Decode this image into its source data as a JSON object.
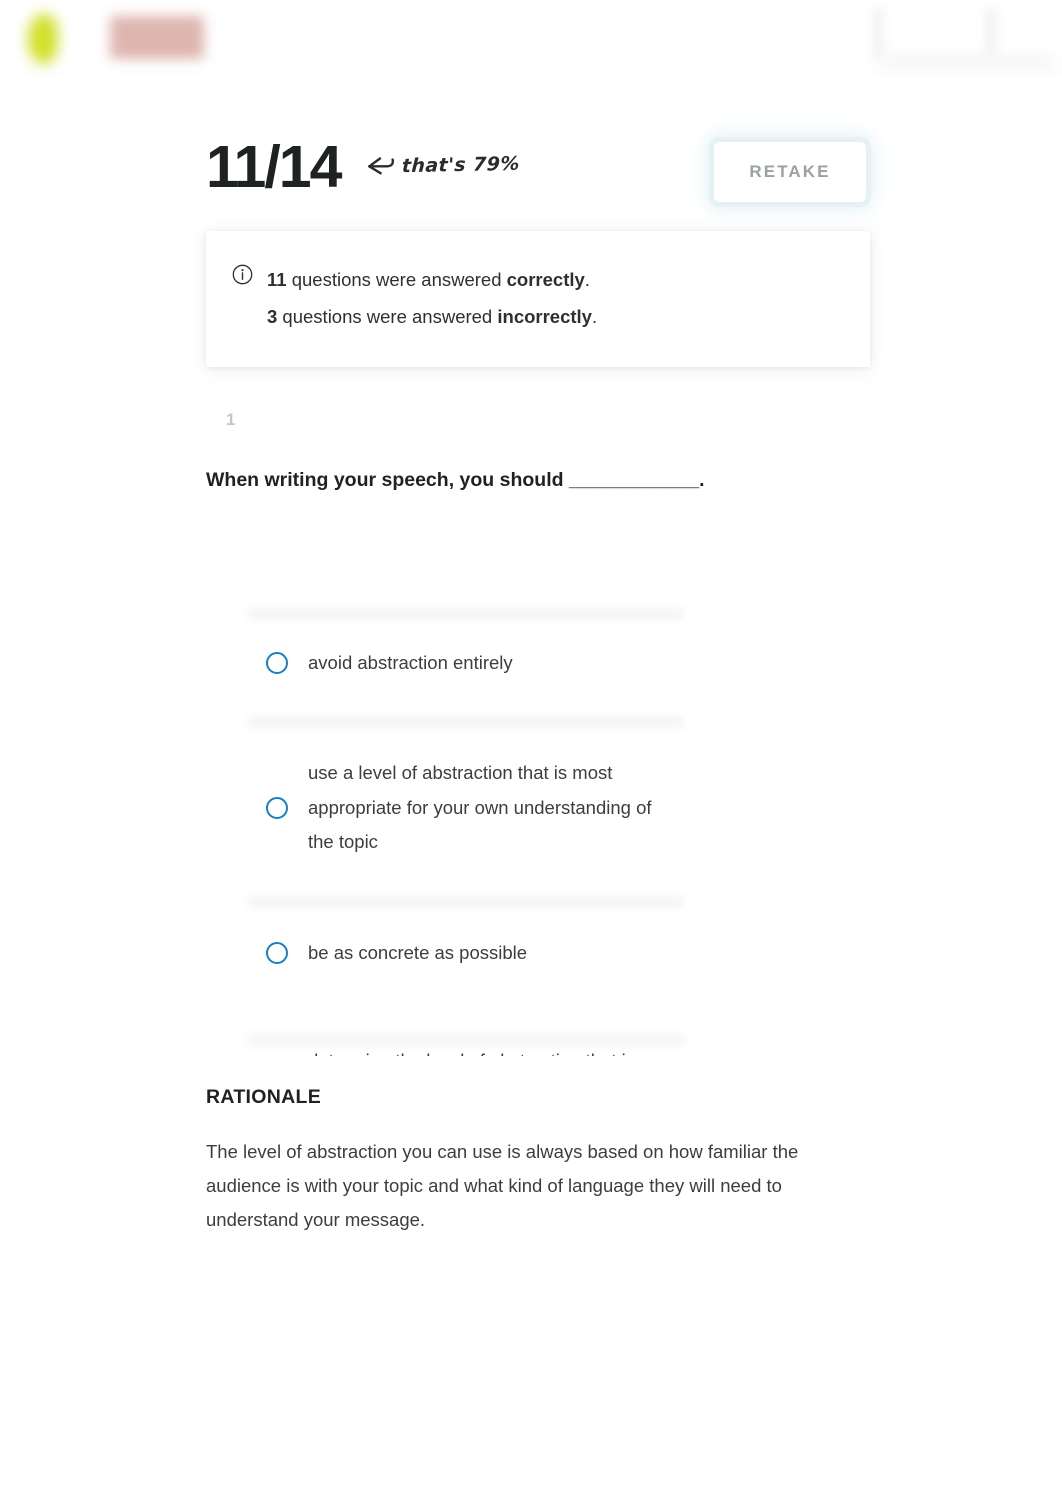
{
  "topbar": {
    "logo_name": "leaf-logo-redacted",
    "wordmark_name": "wordmark-redacted"
  },
  "score_header": {
    "score": "11/14",
    "annotation_text": "that's 79%",
    "annotation_arrow": "curved-left-arrow-icon",
    "retake_label": "RETAKE"
  },
  "info_box": {
    "icon": "info-circle-icon",
    "line1": {
      "count": "11",
      "mid": " questions were answered ",
      "emphasis": "correctly",
      "end": "."
    },
    "line2": {
      "count": "3",
      "mid": " questions were answered ",
      "emphasis": "incorrectly",
      "end": "."
    }
  },
  "question": {
    "number": "1",
    "prompt": "When writing your speech, you should ____________.",
    "options": [
      {
        "label": "avoid abstraction entirely",
        "selected": false,
        "correct": false
      },
      {
        "label": "use a level of abstraction that is most appropriate for your own understanding of the topic",
        "selected": false,
        "correct": false
      },
      {
        "label": "be as concrete as possible",
        "selected": false,
        "correct": false
      },
      {
        "label": "determine the level of abstraction that is most appropriate for your audience",
        "selected": true,
        "correct": true
      }
    ]
  },
  "rationale": {
    "heading": "RATIONALE",
    "text": "The level of abstraction you can use is always based on how familiar the audience is with your topic and what kind of language they will need to understand your message."
  },
  "colors": {
    "radio_blue": "#1780c4",
    "correct_green": "#2ba45e",
    "text_dark": "#2d3032",
    "muted_grey": "#9ba0a3",
    "logo_green": "#ccdd16",
    "wordmark_pink": "#d9a9a2"
  }
}
